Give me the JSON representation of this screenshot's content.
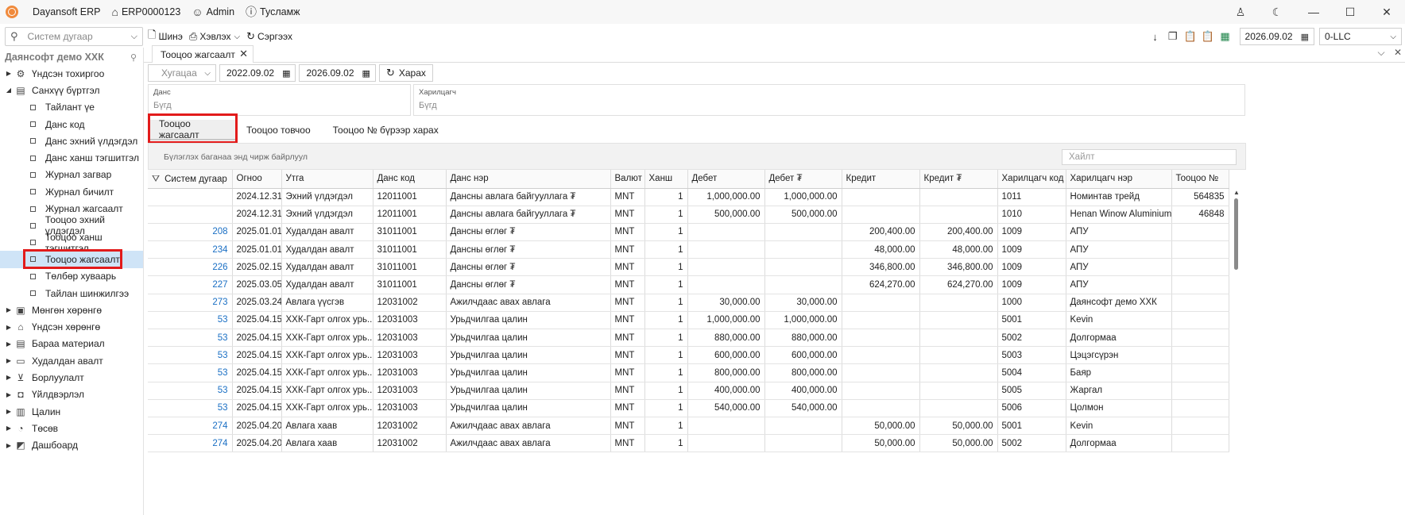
{
  "titlebar": {
    "app_name": "Dayansoft ERP",
    "company_code": "ERP0000123",
    "user": "Admin",
    "help": "Тусламж"
  },
  "toolbar": {
    "search_placeholder": "Систем дугаар",
    "new_label": "Шинэ",
    "print_label": "Хэвлэх",
    "refresh_label": "Сэргээх",
    "current_date": "2026.09.02",
    "org": "0-LLC"
  },
  "sidebar": {
    "company": "Даянсофт демо ХХК",
    "items": [
      {
        "label": "Үндсэн тохиргоо",
        "icon": "gear-icon"
      },
      {
        "label": "Санхүү бүртгэл",
        "icon": "ledger-icon"
      },
      {
        "label": "Тайлант үе"
      },
      {
        "label": "Данс код"
      },
      {
        "label": "Данс эхний үлдэгдэл"
      },
      {
        "label": "Данс ханш тэгшитгэл"
      },
      {
        "label": "Журнал загвар"
      },
      {
        "label": "Журнал бичилт"
      },
      {
        "label": "Журнал жагсаалт"
      },
      {
        "label": "Тооцоо эхний үлдэгдэл"
      },
      {
        "label": "Тооцоо ханш тэгшитгэл"
      },
      {
        "label": "Тооцоо жагсаалт"
      },
      {
        "label": "Төлбөр хуваарь"
      },
      {
        "label": "Тайлан шинжилгээ"
      },
      {
        "label": "Мөнгөн хөрөнгө",
        "icon": "cash-icon"
      },
      {
        "label": "Үндсэн хөрөнгө",
        "icon": "asset-icon"
      },
      {
        "label": "Бараа материал",
        "icon": "inventory-icon"
      },
      {
        "label": "Худалдан авалт",
        "icon": "purchase-icon"
      },
      {
        "label": "Борлуулалт",
        "icon": "cart-icon"
      },
      {
        "label": "Үйлдвэрлэл",
        "icon": "production-icon"
      },
      {
        "label": "Цалин",
        "icon": "salary-icon"
      },
      {
        "label": "Төсөв",
        "icon": "budget-icon"
      },
      {
        "label": "Дашбоард",
        "icon": "dashboard-icon"
      }
    ]
  },
  "main": {
    "doc_tab": "Тооцоо жагсаалт",
    "filter": {
      "period_placeholder": "Хугацаа",
      "date_from": "2022.09.02",
      "date_to": "2026.09.02",
      "view_label": "Харах"
    },
    "account": {
      "label": "Данс",
      "value": "Бүгд"
    },
    "customer": {
      "label": "Харилцагч",
      "value": "Бүгд"
    },
    "tabs": [
      "Тооцоо жагсаалт",
      "Тооцоо товчоо",
      "Тооцоо № бүрээр харах"
    ],
    "group_hint": "Бүлэглэх баганаа энд чирж байрлуул",
    "find_placeholder": "Хайлт"
  },
  "grid": {
    "columns": [
      "Систем дугаар",
      "Огноо",
      "Утга",
      "Данс код",
      "Данс нэр",
      "Валют",
      "Ханш",
      "Дебет",
      "Дебет ₮",
      "Кредит",
      "Кредит ₮",
      "Харилцагч код",
      "Харилцагч нэр",
      "Тооцоо №"
    ],
    "rows": [
      [
        "",
        "2024.12.31",
        "Эхний үлдэгдэл",
        "12011001",
        "Дансны авлага байгууллага ₮",
        "MNT",
        "1",
        "1,000,000.00",
        "1,000,000.00",
        "",
        "",
        "1011",
        "Номинтав трейд",
        "564835"
      ],
      [
        "",
        "2024.12.31",
        "Эхний үлдэгдэл",
        "12011001",
        "Дансны авлага байгууллага ₮",
        "MNT",
        "1",
        "500,000.00",
        "500,000.00",
        "",
        "",
        "1010",
        "Henan Winow Aluminium",
        "46848"
      ],
      [
        "208",
        "2025.01.01",
        "Худалдан авалт",
        "31011001",
        "Дансны өглөг ₮",
        "MNT",
        "1",
        "",
        "",
        "200,400.00",
        "200,400.00",
        "1009",
        "АПУ",
        ""
      ],
      [
        "234",
        "2025.01.01",
        "Худалдан авалт",
        "31011001",
        "Дансны өглөг ₮",
        "MNT",
        "1",
        "",
        "",
        "48,000.00",
        "48,000.00",
        "1009",
        "АПУ",
        ""
      ],
      [
        "226",
        "2025.02.15",
        "Худалдан авалт",
        "31011001",
        "Дансны өглөг ₮",
        "MNT",
        "1",
        "",
        "",
        "346,800.00",
        "346,800.00",
        "1009",
        "АПУ",
        ""
      ],
      [
        "227",
        "2025.03.05",
        "Худалдан авалт",
        "31011001",
        "Дансны өглөг ₮",
        "MNT",
        "1",
        "",
        "",
        "624,270.00",
        "624,270.00",
        "1009",
        "АПУ",
        ""
      ],
      [
        "273",
        "2025.03.24",
        "Авлага үүсгэв",
        "12031002",
        "Ажилчдаас авах авлага",
        "MNT",
        "1",
        "30,000.00",
        "30,000.00",
        "",
        "",
        "1000",
        "Даянсофт демо ХХК",
        ""
      ],
      [
        "53",
        "2025.04.15",
        "ХХК-Гарт олгох урь...",
        "12031003",
        "Урьдчилгаа цалин",
        "MNT",
        "1",
        "1,000,000.00",
        "1,000,000.00",
        "",
        "",
        "5001",
        "Kevin",
        ""
      ],
      [
        "53",
        "2025.04.15",
        "ХХК-Гарт олгох урь...",
        "12031003",
        "Урьдчилгаа цалин",
        "MNT",
        "1",
        "880,000.00",
        "880,000.00",
        "",
        "",
        "5002",
        "Долгормаа",
        ""
      ],
      [
        "53",
        "2025.04.15",
        "ХХК-Гарт олгох урь...",
        "12031003",
        "Урьдчилгаа цалин",
        "MNT",
        "1",
        "600,000.00",
        "600,000.00",
        "",
        "",
        "5003",
        "Цэцэгсүрэн",
        ""
      ],
      [
        "53",
        "2025.04.15",
        "ХХК-Гарт олгох урь...",
        "12031003",
        "Урьдчилгаа цалин",
        "MNT",
        "1",
        "800,000.00",
        "800,000.00",
        "",
        "",
        "5004",
        "Баяр",
        ""
      ],
      [
        "53",
        "2025.04.15",
        "ХХК-Гарт олгох урь...",
        "12031003",
        "Урьдчилгаа цалин",
        "MNT",
        "1",
        "400,000.00",
        "400,000.00",
        "",
        "",
        "5005",
        "Жаргал",
        ""
      ],
      [
        "53",
        "2025.04.15",
        "ХХК-Гарт олгох урь...",
        "12031003",
        "Урьдчилгаа цалин",
        "MNT",
        "1",
        "540,000.00",
        "540,000.00",
        "",
        "",
        "5006",
        "Цолмон",
        ""
      ],
      [
        "274",
        "2025.04.20",
        "Авлага хаав",
        "12031002",
        "Ажилчдаас авах авлага",
        "MNT",
        "1",
        "",
        "",
        "50,000.00",
        "50,000.00",
        "5001",
        "Kevin",
        ""
      ],
      [
        "274",
        "2025.04.20",
        "Авлага хаав",
        "12031002",
        "Ажилчдаас авах авлага",
        "MNT",
        "1",
        "",
        "",
        "50,000.00",
        "50,000.00",
        "5002",
        "Долгормаа",
        ""
      ]
    ]
  }
}
